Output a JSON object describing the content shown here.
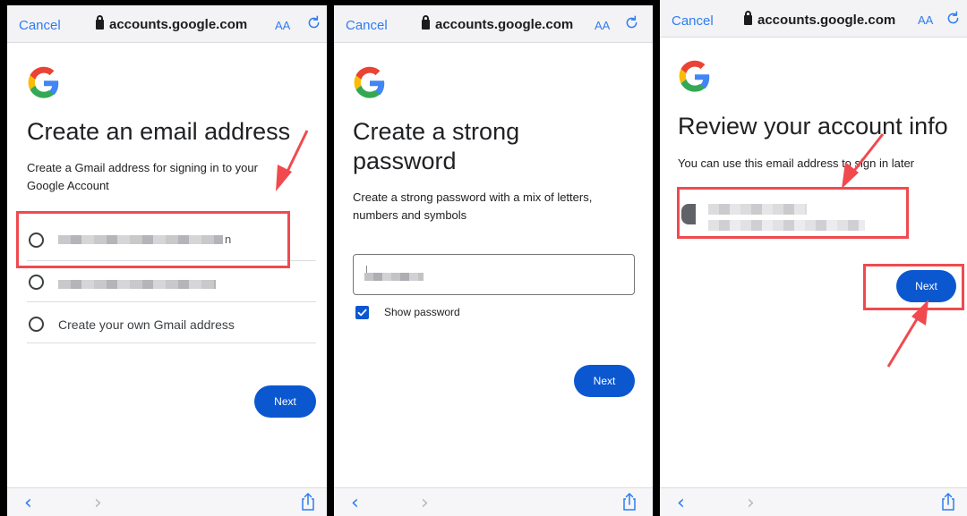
{
  "browser": {
    "cancel_label": "Cancel",
    "url": "accounts.google.com",
    "text_size_label": "AA"
  },
  "screen1": {
    "title": "Create an email address",
    "subtitle": "Create a Gmail address for signing in to your Google Account",
    "option1_tail": "n",
    "option3_label": "Create your own Gmail address",
    "next_label": "Next"
  },
  "screen2": {
    "title": "Create a strong password",
    "subtitle": "Create a strong password with a mix of letters, numbers and symbols",
    "show_password_label": "Show password",
    "show_password_checked": true,
    "next_label": "Next"
  },
  "screen3": {
    "title": "Review your account info",
    "subtitle": "You can use this email address to sign in later",
    "next_label": "Next"
  },
  "colors": {
    "google_blue": "#0b57d0",
    "safari_blue": "#2f7bf3",
    "annotation_red": "#f04a4f"
  },
  "icons": [
    "lock-icon",
    "reload-icon",
    "google-logo",
    "back-icon",
    "forward-icon",
    "share-icon",
    "checkmark-icon"
  ]
}
